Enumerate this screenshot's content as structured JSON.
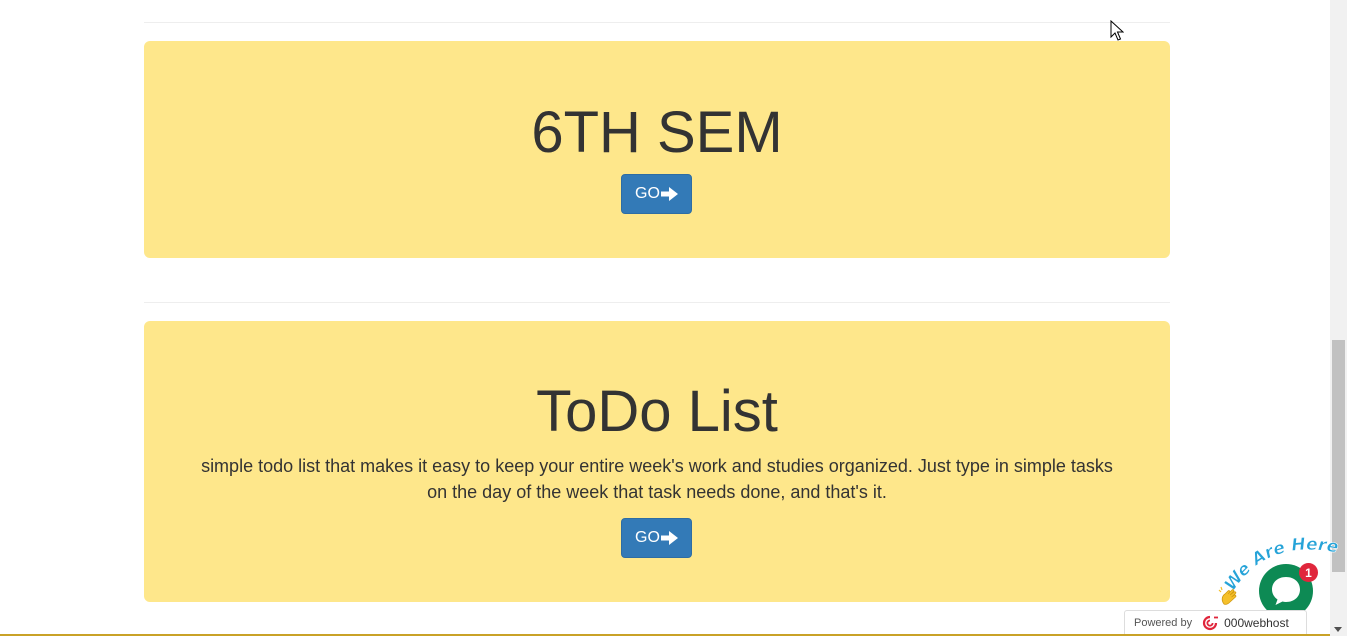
{
  "cards": [
    {
      "title": "6TH SEM",
      "description": "",
      "button_label": "GO"
    },
    {
      "title": "ToDo List",
      "description": "simple todo list that makes it easy to keep your entire week's work and studies organized. Just type in simple tasks on the day of the week that task needs done, and that's it.",
      "button_label": "GO"
    }
  ],
  "chat_widget": {
    "tagline": "We Are Here!",
    "unread_count": "1"
  },
  "powered_by": {
    "label": "Powered by",
    "host": "000webhost"
  },
  "colors": {
    "card_background": "#fee78b",
    "button_primary": "#337ab7",
    "chat_green": "#0d8a54",
    "badge_red": "#e0263c"
  },
  "icons": {
    "go_arrow": "arrow-right-icon",
    "chat": "chat-icon",
    "wave": "waving-hand-icon",
    "host_logo": "000webhost-logo-icon"
  }
}
